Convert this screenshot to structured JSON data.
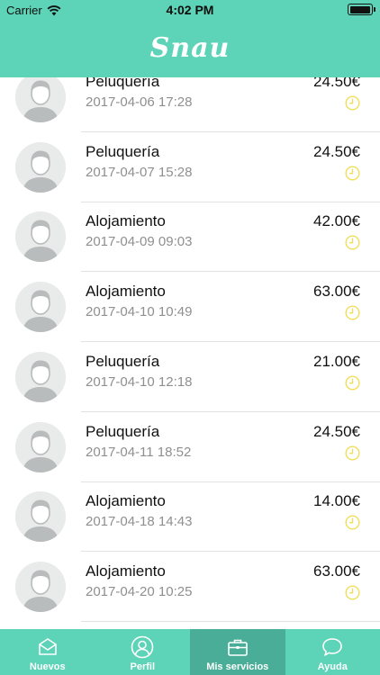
{
  "status_bar": {
    "carrier": "Carrier",
    "time": "4:02 PM",
    "battery_level": 1.0
  },
  "header": {
    "title": "Snau"
  },
  "services": [
    {
      "title": "Peluquería",
      "date": "2017-04-06 17:28",
      "price": "24.50€",
      "status_icon": "clock-icon"
    },
    {
      "title": "Peluquería",
      "date": "2017-04-07 15:28",
      "price": "24.50€",
      "status_icon": "clock-icon"
    },
    {
      "title": "Alojamiento",
      "date": "2017-04-09 09:03",
      "price": "42.00€",
      "status_icon": "clock-icon"
    },
    {
      "title": "Alojamiento",
      "date": "2017-04-10 10:49",
      "price": "63.00€",
      "status_icon": "clock-icon"
    },
    {
      "title": "Peluquería",
      "date": "2017-04-10 12:18",
      "price": "21.00€",
      "status_icon": "clock-icon"
    },
    {
      "title": "Peluquería",
      "date": "2017-04-11 18:52",
      "price": "24.50€",
      "status_icon": "clock-icon"
    },
    {
      "title": "Alojamiento",
      "date": "2017-04-18 14:43",
      "price": "14.00€",
      "status_icon": "clock-icon"
    },
    {
      "title": "Alojamiento",
      "date": "2017-04-20 10:25",
      "price": "63.00€",
      "status_icon": "clock-icon"
    }
  ],
  "tabbar": {
    "items": [
      {
        "label": "Nuevos",
        "icon": "inbox-icon",
        "active": false
      },
      {
        "label": "Perfil",
        "icon": "profile-icon",
        "active": false
      },
      {
        "label": "Mis servicios",
        "icon": "briefcase-icon",
        "active": true
      },
      {
        "label": "Ayuda",
        "icon": "chat-bubble-icon",
        "active": false
      }
    ]
  },
  "colors": {
    "brand": "#5dd3b7",
    "tab_active": "#4aad97",
    "pending_clock": "#f0de5a",
    "secondary_text": "#8f8f8f"
  }
}
